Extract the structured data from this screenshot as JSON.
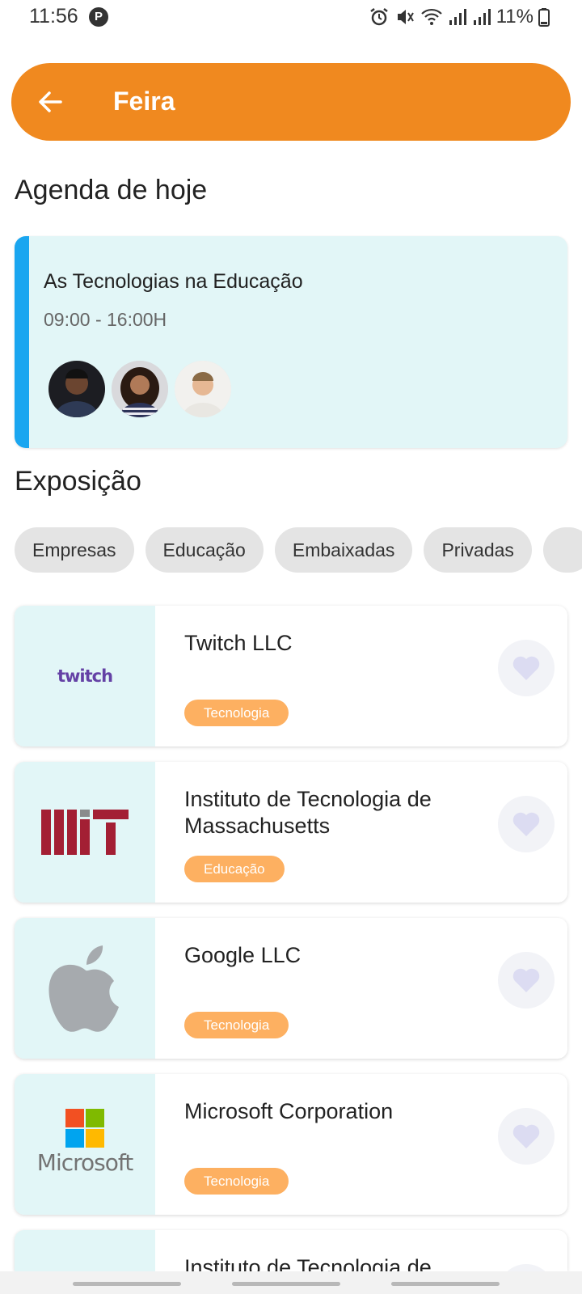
{
  "status_bar": {
    "time": "11:56",
    "notification_icon": "p-icon",
    "battery_text": "11%"
  },
  "header": {
    "title": "Feira",
    "back_icon": "arrow-left-icon",
    "color": "#f0891f"
  },
  "agenda": {
    "section_title": "Agenda de hoje",
    "event": {
      "title": "As Tecnologias na Educação",
      "time": "09:00  -  16:00H",
      "attendee_count": 3
    },
    "accent_color": "#1aa6f0"
  },
  "exhibition": {
    "section_title": "Exposição",
    "chips": [
      {
        "label": "Empresas"
      },
      {
        "label": "Educação"
      },
      {
        "label": "Embaixadas"
      },
      {
        "label": "Privadas"
      },
      {
        "label": ""
      }
    ],
    "items": [
      {
        "name": "Twitch LLC",
        "tag": "Tecnologia",
        "logo": "twitch-logo",
        "logo_text": "twitch"
      },
      {
        "name": "Instituto de Tecnologia de Massachusetts",
        "tag": "Educação",
        "logo": "mit-logo"
      },
      {
        "name": "Google LLC",
        "tag": "Tecnologia",
        "logo": "apple-logo"
      },
      {
        "name": "Microsoft Corporation",
        "tag": "Tecnologia",
        "logo": "microsoft-logo",
        "logo_text": "Microsoft"
      },
      {
        "name": "Instituto de Tecnologia de",
        "tag": "",
        "logo": ""
      }
    ],
    "tag_color": "#fdb061"
  }
}
